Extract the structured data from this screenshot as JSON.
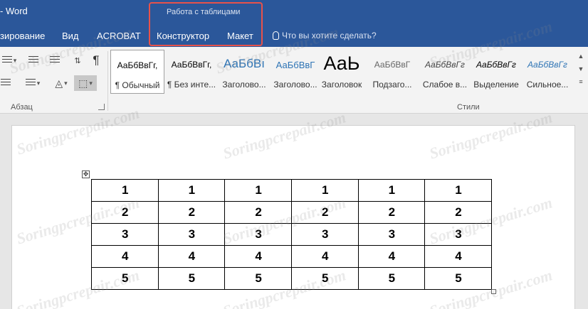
{
  "title_bar": {
    "app_title": "- Word",
    "tabs": [
      "зирование",
      "Вид",
      "ACROBAT"
    ],
    "context_group": {
      "title": "Работа с таблицами",
      "tabs": [
        "Конструктор",
        "Макет"
      ]
    },
    "tell_me": "Что вы хотите сделать?"
  },
  "ribbon": {
    "paragraph_group_label": "Абзац",
    "styles_group_label": "Стили",
    "styles": [
      {
        "sample": "АаБбВвГг,",
        "name": "¶ Обычный"
      },
      {
        "sample": "АаБбВвГг,",
        "name": "¶ Без инте..."
      },
      {
        "sample": "АаБбВı",
        "name": "Заголово..."
      },
      {
        "sample": "АаБбВвГ",
        "name": "Заголово..."
      },
      {
        "sample": "АаЬ",
        "name": "Заголовок"
      },
      {
        "sample": "АаБбВвГ",
        "name": "Подзаго..."
      },
      {
        "sample": "АаБбВвГг",
        "name": "Слабое в..."
      },
      {
        "sample": "АаБбВвГг",
        "name": "Выделение"
      },
      {
        "sample": "АаБбВвГг",
        "name": "Сильное..."
      }
    ]
  },
  "table": {
    "rows": [
      [
        "1",
        "1",
        "1",
        "1",
        "1",
        "1"
      ],
      [
        "2",
        "2",
        "2",
        "2",
        "2",
        "2"
      ],
      [
        "3",
        "3",
        "3",
        "3",
        "3",
        "3"
      ],
      [
        "4",
        "4",
        "4",
        "4",
        "4",
        "4"
      ],
      [
        "5",
        "5",
        "5",
        "5",
        "5",
        "5"
      ]
    ]
  },
  "watermark": "Soringpcrepair.com",
  "colors": {
    "title_bar": "#2b579a",
    "ribbon": "#f3f3f3",
    "highlight_box": "#e8524a",
    "document_bg": "#e6e6e6"
  }
}
